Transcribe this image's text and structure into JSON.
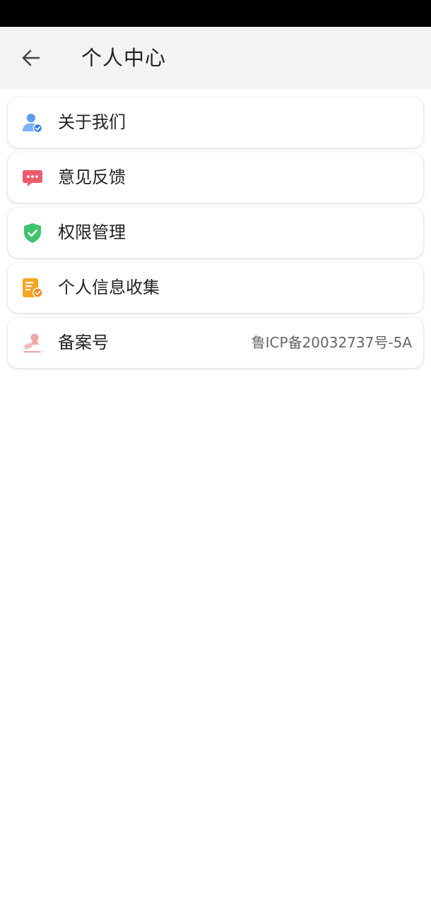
{
  "header": {
    "title": "个人中心"
  },
  "menu": {
    "items": [
      {
        "label": "关于我们",
        "icon": "user-check-icon",
        "color": "#4a90e2"
      },
      {
        "label": "意见反馈",
        "icon": "chat-bubble-icon",
        "color": "#ee5b6f"
      },
      {
        "label": "权限管理",
        "icon": "shield-check-icon",
        "color": "#3ec46d"
      },
      {
        "label": "个人信息收集",
        "icon": "document-check-icon",
        "color": "#f5a623"
      },
      {
        "label": "备案号",
        "icon": "stamp-icon",
        "color": "#f2a6a6",
        "value": "鲁ICP备20032737号-5A"
      }
    ]
  }
}
